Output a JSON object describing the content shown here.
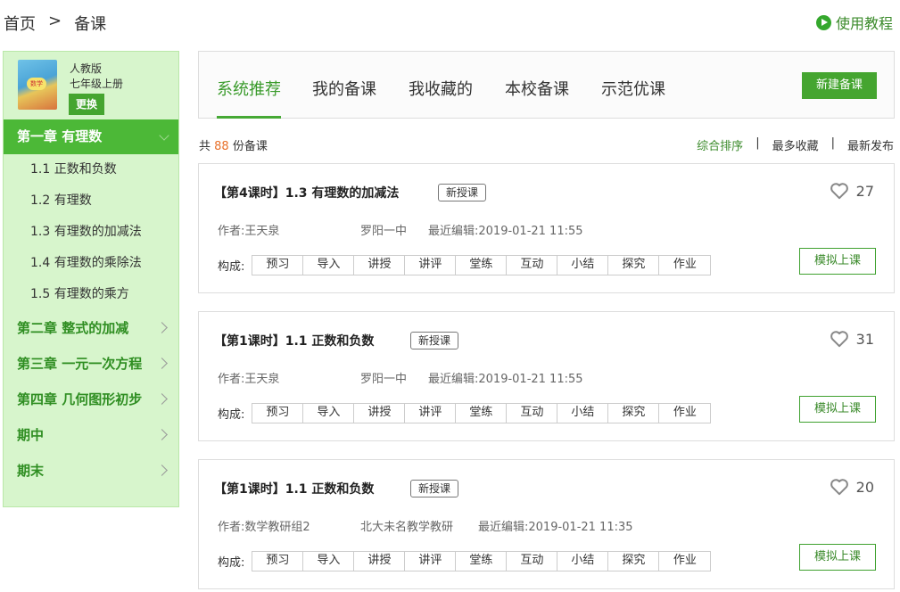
{
  "breadcrumb": {
    "home": "首页",
    "sep": ">",
    "current": "备课"
  },
  "tutorial": {
    "label": "使用教程",
    "icon": "play-icon"
  },
  "sidebar": {
    "book": {
      "cover_text": "数学",
      "edition": "人教版",
      "grade": "七年级上册",
      "change_label": "更换"
    },
    "active_chapter": "第一章 有理数",
    "lessons": [
      "1.1 正数和负数",
      "1.2 有理数",
      "1.3 有理数的加减法",
      "1.4 有理数的乘除法",
      "1.5 有理数的乘方"
    ],
    "chapters": [
      "第二章 整式的加减",
      "第三章 一元一次方程",
      "第四章 几何图形初步",
      "期中",
      "期末"
    ]
  },
  "tabs": [
    "系统推荐",
    "我的备课",
    "我收藏的",
    "本校备课",
    "示范优课"
  ],
  "new_button": "新建备课",
  "count": {
    "prefix": "共",
    "value": "88",
    "suffix": "份备课"
  },
  "sort": {
    "options": [
      "综合排序",
      "最多收藏",
      "最新发布"
    ],
    "separator": "|"
  },
  "compose_label": "构成:",
  "simulate_label": "模拟上课",
  "segments": [
    "预习",
    "导入",
    "讲授",
    "讲评",
    "堂练",
    "互动",
    "小结",
    "探究",
    "作业"
  ],
  "cards": [
    {
      "title": "【第4课时】1.3 有理数的加减法",
      "badge": "新授课",
      "likes": "27",
      "author": "作者:王天泉",
      "school": "罗阳一中",
      "edited": "最近编辑:2019-01-21 11:55"
    },
    {
      "title": "【第1课时】1.1 正数和负数",
      "badge": "新授课",
      "likes": "31",
      "author": "作者:王天泉",
      "school": "罗阳一中",
      "edited": "最近编辑:2019-01-21 11:55"
    },
    {
      "title": "【第1课时】1.1 正数和负数",
      "badge": "新授课",
      "likes": "20",
      "author": "作者:数学教研组2",
      "school": "北大未名教学教研",
      "edited": "最近编辑:2019-01-21 11:35"
    }
  ],
  "colors": {
    "brand_green": "#45a530",
    "sidebar_bg": "#d7f5cc",
    "accent_orange": "#e8702a"
  }
}
